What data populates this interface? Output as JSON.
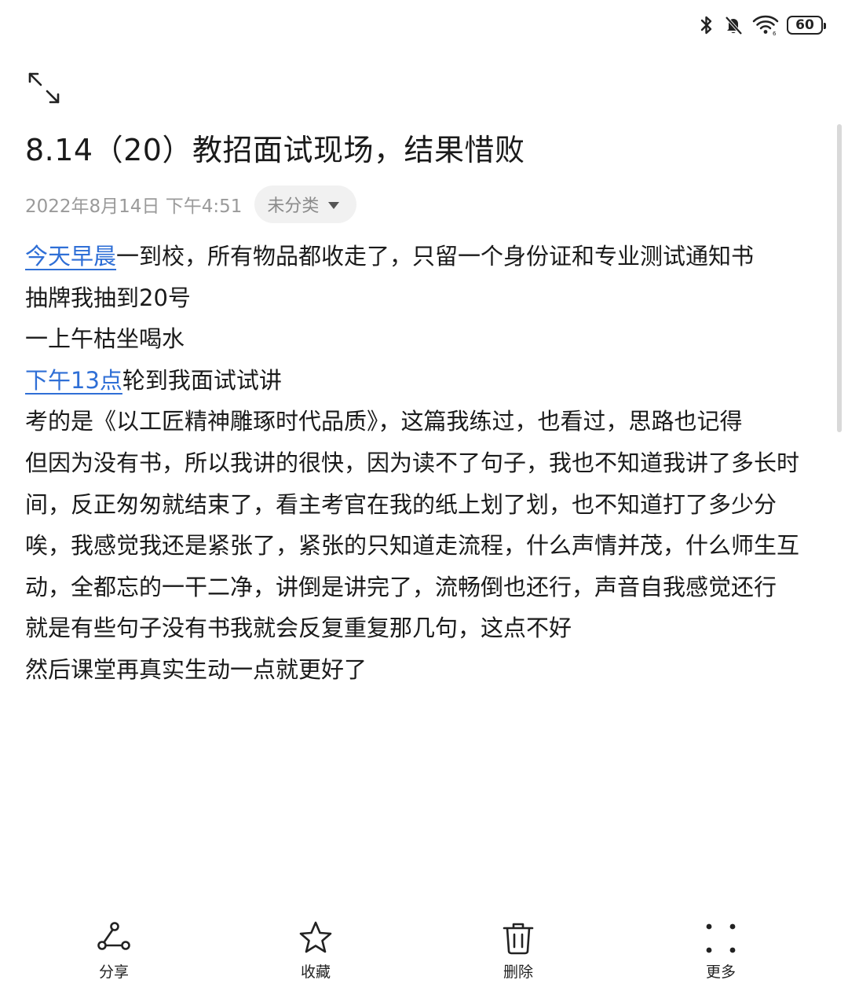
{
  "status_bar": {
    "icons": [
      "bluetooth-icon",
      "mute-bell-icon",
      "wifi-icon"
    ],
    "battery": "60"
  },
  "note": {
    "title": "8.14（20）教招面试现场，结果惜败",
    "date": "2022年8月14日 下午4:51",
    "category": "未分类",
    "paragraphs": [
      {
        "link": "今天早晨",
        "text": "一到校，所有物品都收走了，只留一个身份证和专业测试通知书"
      },
      {
        "link": "",
        "text": "抽牌我抽到20号"
      },
      {
        "link": "",
        "text": "一上午枯坐喝水"
      },
      {
        "link": "下午13点",
        "text": "轮到我面试试讲"
      },
      {
        "link": "",
        "text": "考的是《以工匠精神雕琢时代品质》，这篇我练过，也看过，思路也记得"
      },
      {
        "link": "",
        "text": "但因为没有书，所以我讲的很快，因为读不了句子，我也不知道我讲了多长时间，反正匆匆就结束了，看主考官在我的纸上划了划，也不知道打了多少分"
      },
      {
        "link": "",
        "text": "唉，我感觉我还是紧张了，紧张的只知道走流程，什么声情并茂，什么师生互动，全都忘的一干二净，讲倒是讲完了，流畅倒也还行，声音自我感觉还行"
      },
      {
        "link": "",
        "text": "就是有些句子没有书我就会反复重复那几句，这点不好"
      },
      {
        "link": "",
        "text": "然后课堂再真实生动一点就更好了"
      }
    ]
  },
  "toolbar": {
    "share": "分享",
    "favorite": "收藏",
    "delete": "删除",
    "more": "更多"
  },
  "colors": {
    "link": "#2f6fd6",
    "meta_text": "#9a9a9a",
    "chip_bg": "#f1f1f1"
  }
}
